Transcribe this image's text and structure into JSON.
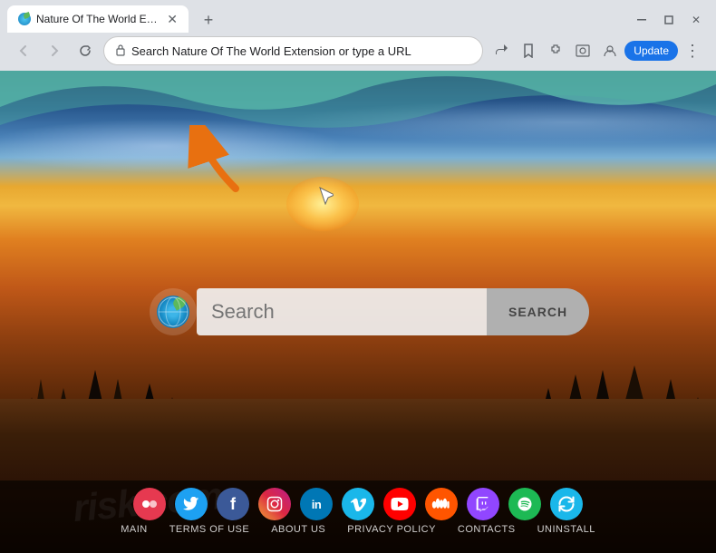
{
  "browser": {
    "tab": {
      "title": "Nature Of The World Extension",
      "favicon_color": "#3db5e8"
    },
    "address_bar": {
      "url": "Search Nature Of The World Extension or type a URL",
      "placeholder": "Search Nature Of The World Extension or type a URL"
    },
    "update_btn": "Update",
    "window_controls": {
      "minimize": "─",
      "maximize": "□",
      "close": "✕"
    }
  },
  "page": {
    "search": {
      "input_placeholder": "Search",
      "button_label": "SEARCH"
    },
    "bottom_nav": {
      "links": [
        "MAIN",
        "TERMS OF USE",
        "ABOUT US",
        "PRIVACY POLICY",
        "CONTACTS",
        "UNINSTALL"
      ]
    },
    "social_icons": [
      {
        "name": "dots-icon",
        "bg": "#e63950",
        "symbol": "⬤⬤"
      },
      {
        "name": "bird-icon",
        "bg": "#2d9cdb",
        "symbol": "🐦"
      },
      {
        "name": "plus-icon",
        "bg": "#3b5998",
        "symbol": "+"
      },
      {
        "name": "instagram-icon",
        "bg": "#c13584",
        "symbol": "📷"
      },
      {
        "name": "linkedin-icon",
        "bg": "#0077b5",
        "symbol": "in"
      },
      {
        "name": "vimeo-icon",
        "bg": "#1ab7ea",
        "symbol": "V"
      },
      {
        "name": "youtube-icon",
        "bg": "#ff0000",
        "symbol": "▶"
      },
      {
        "name": "soundcloud-icon",
        "bg": "#ff5500",
        "symbol": "☁"
      },
      {
        "name": "twitch-icon",
        "bg": "#9146ff",
        "symbol": "T"
      },
      {
        "name": "spotify-icon",
        "bg": "#1db954",
        "symbol": "◎"
      },
      {
        "name": "refresh-icon",
        "bg": "#1ab7ea",
        "symbol": "↻"
      }
    ]
  }
}
